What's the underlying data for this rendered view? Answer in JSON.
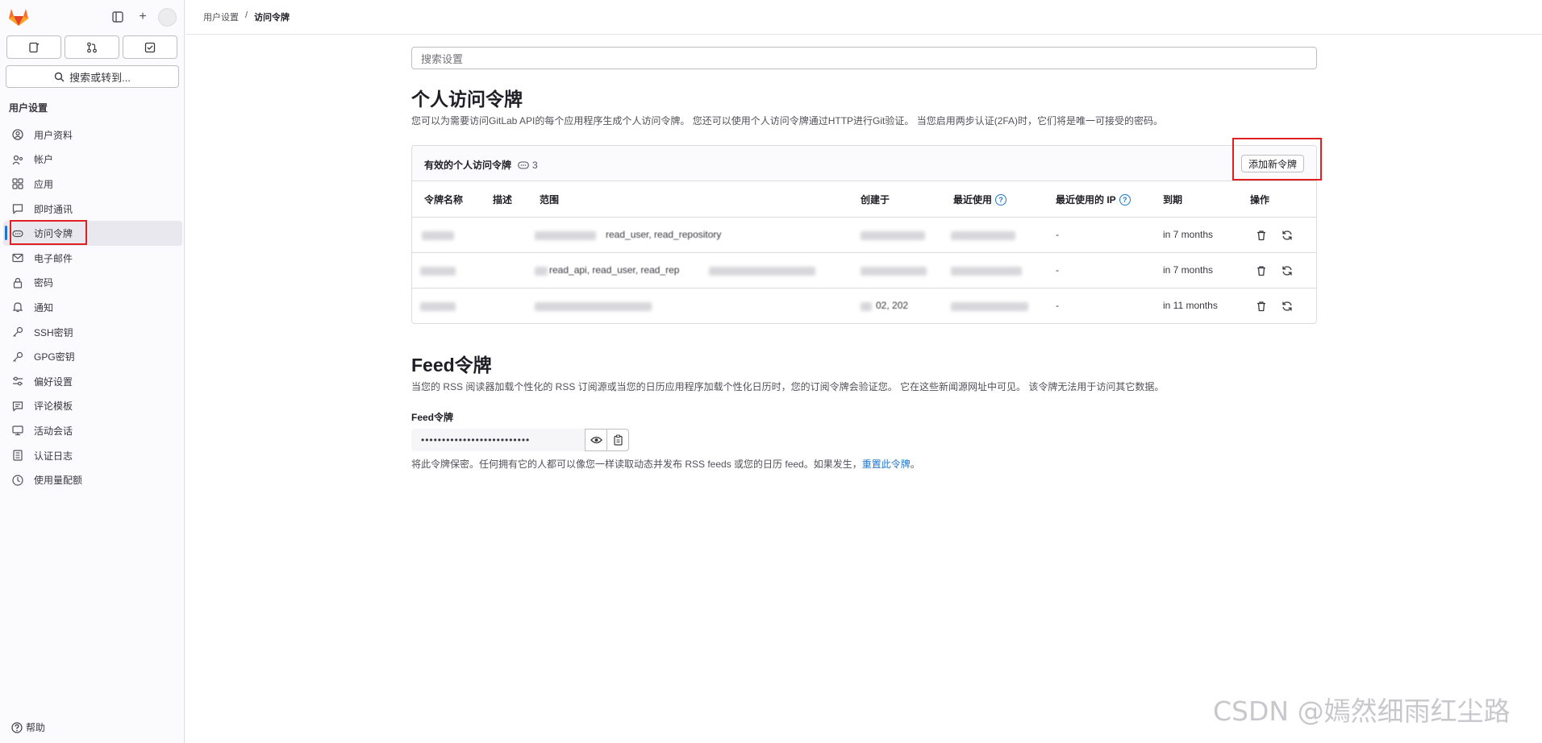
{
  "sidebar": {
    "search_label": "搜索或转到...",
    "section_label": "用户设置",
    "items": [
      {
        "label": "用户资料",
        "icon": "user-circle-icon"
      },
      {
        "label": "帐户",
        "icon": "account-icon"
      },
      {
        "label": "应用",
        "icon": "applications-icon"
      },
      {
        "label": "即时通讯",
        "icon": "chat-icon"
      },
      {
        "label": "访问令牌",
        "icon": "token-icon",
        "active": true
      },
      {
        "label": "电子邮件",
        "icon": "mail-icon"
      },
      {
        "label": "密码",
        "icon": "lock-icon"
      },
      {
        "label": "通知",
        "icon": "bell-icon"
      },
      {
        "label": "SSH密钥",
        "icon": "key-icon"
      },
      {
        "label": "GPG密钥",
        "icon": "key-icon"
      },
      {
        "label": "偏好设置",
        "icon": "preferences-icon"
      },
      {
        "label": "评论模板",
        "icon": "comment-template-icon"
      },
      {
        "label": "活动会话",
        "icon": "monitor-icon"
      },
      {
        "label": "认证日志",
        "icon": "log-icon"
      },
      {
        "label": "使用量配额",
        "icon": "quota-icon"
      }
    ],
    "help_label": "帮助"
  },
  "breadcrumb": {
    "parent": "用户设置",
    "separator": "/",
    "current": "访问令牌"
  },
  "main": {
    "search_placeholder": "搜索设置",
    "title": "个人访问令牌",
    "description": "您可以为需要访问GitLab API的每个应用程序生成个人访问令牌。 您还可以使用个人访问令牌通过HTTP进行Git验证。 当您启用两步认证(2FA)时，它们将是唯一可接受的密码。",
    "card": {
      "title": "有效的个人访问令牌",
      "count": "3",
      "add_button": "添加新令牌",
      "columns": [
        "令牌名称",
        "描述",
        "范围",
        "创建于",
        "最近使用",
        "最近使用的 IP",
        "到期",
        "操作"
      ],
      "rows": [
        {
          "scopes": "read_user, read_repository",
          "last_ip": "-",
          "expires": "in 7 months"
        },
        {
          "scopes": "read_api, read_user, read_rep",
          "last_ip": "-",
          "expires": "in 7 months"
        },
        {
          "scopes": "",
          "created": "02, 202",
          "last_ip": "-",
          "expires": "in 11 months"
        }
      ]
    },
    "feed": {
      "title": "Feed令牌",
      "description": "当您的 RSS 阅读器加载个性化的 RSS 订阅源或当您的日历应用程序加载个性化日历时，您的订阅令牌会验证您。 它在这些新闻源网址中可见。 该令牌无法用于访问其它数据。",
      "label": "Feed令牌",
      "masked_value": "••••••••••••••••••••••••••",
      "note": "将此令牌保密。任何拥有它的人都可以像您一样读取动态并发布 RSS feeds 或您的日历 feed。如果发生，",
      "reset_link": "重置此令牌",
      "note_end": "。"
    }
  },
  "watermark": "CSDN @嫣然细雨红尘路",
  "colors": {
    "accent": "#1f75cb",
    "highlight_box": "#e02020"
  }
}
